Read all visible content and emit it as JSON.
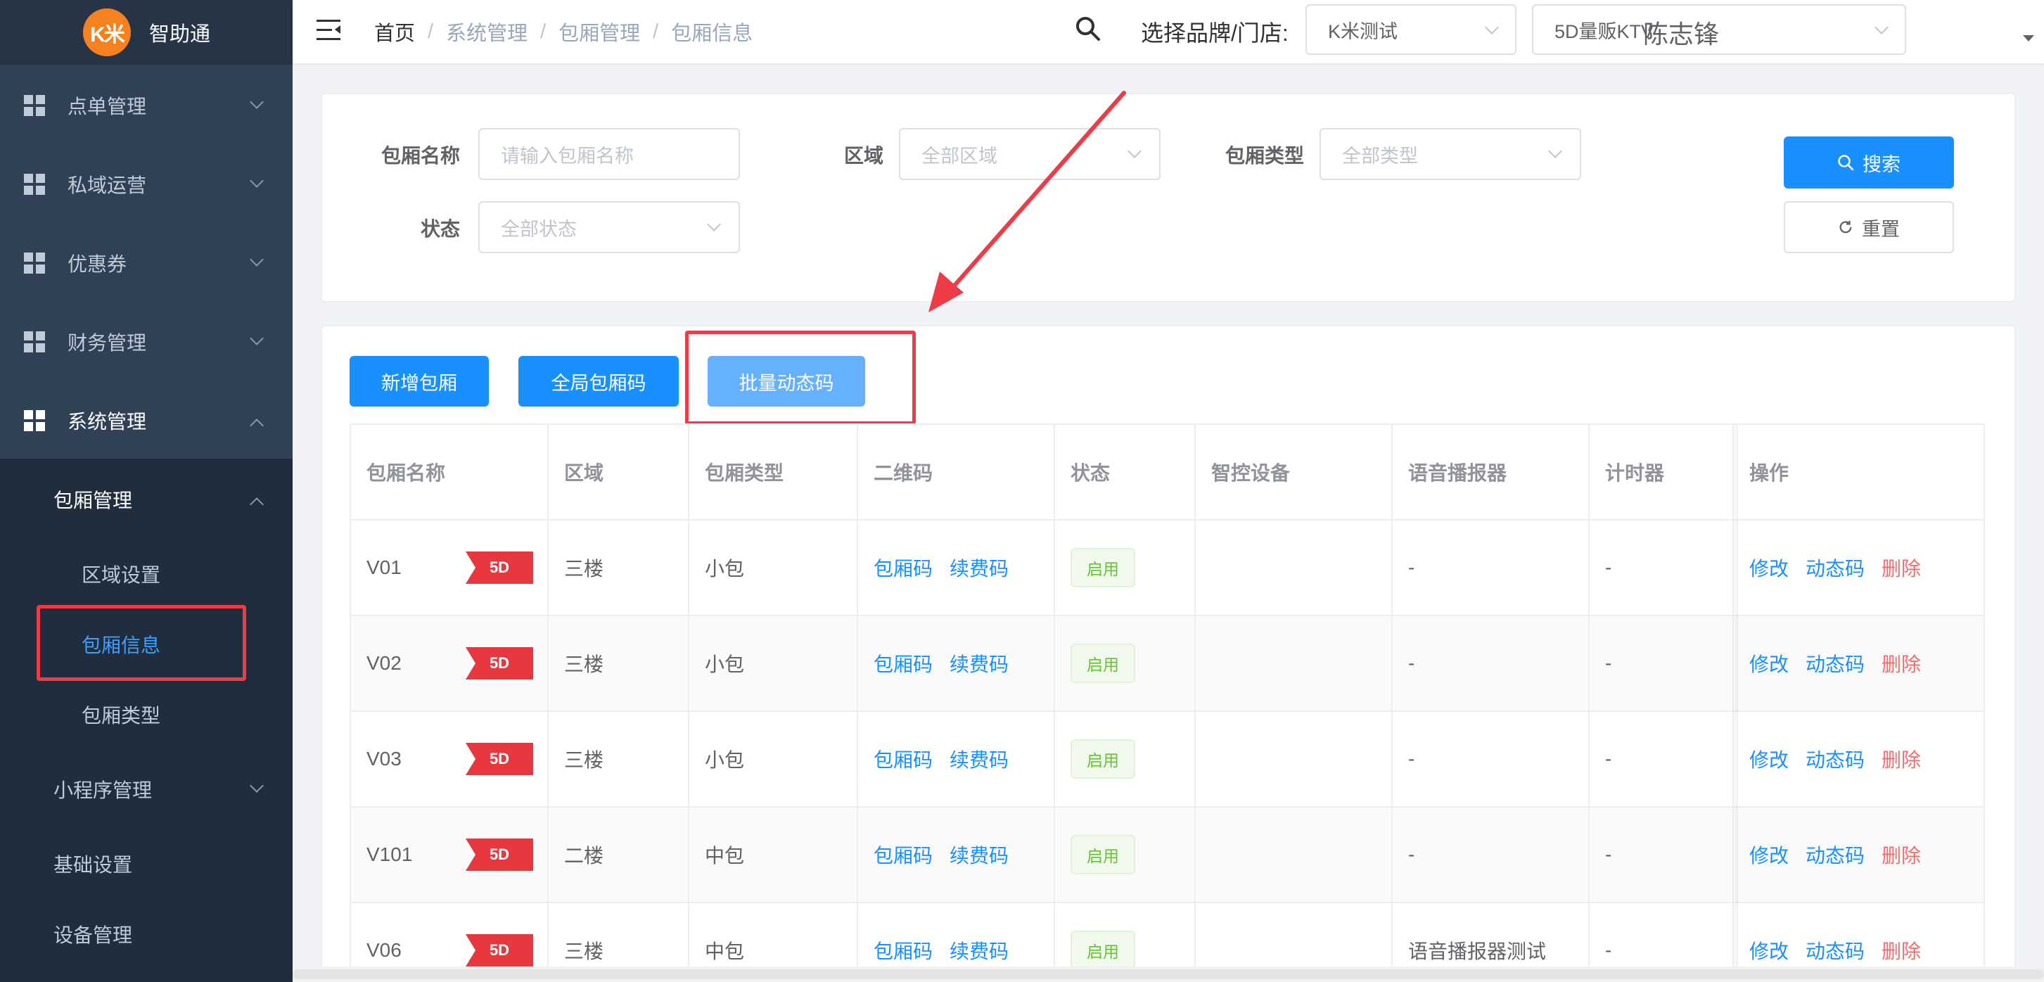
{
  "app": {
    "logo_text": "K米",
    "name": "智助通"
  },
  "sidebar": {
    "items": [
      {
        "label": "点单管理"
      },
      {
        "label": "私域运营"
      },
      {
        "label": "优惠券"
      },
      {
        "label": "财务管理"
      },
      {
        "label": "系统管理"
      }
    ],
    "system_sub": [
      {
        "label": "包厢管理"
      },
      {
        "label": "区域设置"
      },
      {
        "label": "包厢信息"
      },
      {
        "label": "包厢类型"
      },
      {
        "label": "小程序管理"
      },
      {
        "label": "基础设置"
      },
      {
        "label": "设备管理"
      }
    ]
  },
  "header": {
    "breadcrumb": [
      "首页",
      "系统管理",
      "包厢管理",
      "包厢信息"
    ],
    "store_label": "选择品牌/门店:",
    "brand_value": "K米测试",
    "store_value": "5D量贩KTV",
    "user_name": "陈志锋"
  },
  "filters": {
    "name_label": "包厢名称",
    "name_placeholder": "请输入包厢名称",
    "area_label": "区域",
    "area_placeholder": "全部区域",
    "type_label": "包厢类型",
    "type_placeholder": "全部类型",
    "status_label": "状态",
    "status_placeholder": "全部状态",
    "search_btn": "搜索",
    "reset_btn": "重置"
  },
  "toolbar": {
    "add_btn": "新增包厢",
    "global_code_btn": "全局包厢码",
    "batch_code_btn": "批量动态码"
  },
  "table": {
    "columns": [
      "包厢名称",
      "区域",
      "包厢类型",
      "二维码",
      "状态",
      "智控设备",
      "语音播报器",
      "计时器",
      "操作"
    ],
    "rows": [
      {
        "name": "V01",
        "tag": "5D",
        "area": "三楼",
        "type": "小包",
        "qr1": "包厢码",
        "qr2": "续费码",
        "status": "启用",
        "device": "",
        "voice": "-",
        "timer": "-",
        "op_edit": "修改",
        "op_dyn": "动态码",
        "op_del": "删除"
      },
      {
        "name": "V02",
        "tag": "5D",
        "area": "三楼",
        "type": "小包",
        "qr1": "包厢码",
        "qr2": "续费码",
        "status": "启用",
        "device": "",
        "voice": "-",
        "timer": "-",
        "op_edit": "修改",
        "op_dyn": "动态码",
        "op_del": "删除"
      },
      {
        "name": "V03",
        "tag": "5D",
        "area": "三楼",
        "type": "小包",
        "qr1": "包厢码",
        "qr2": "续费码",
        "status": "启用",
        "device": "",
        "voice": "-",
        "timer": "-",
        "op_edit": "修改",
        "op_dyn": "动态码",
        "op_del": "删除"
      },
      {
        "name": "V101",
        "tag": "5D",
        "area": "二楼",
        "type": "中包",
        "qr1": "包厢码",
        "qr2": "续费码",
        "status": "启用",
        "device": "",
        "voice": "-",
        "timer": "-",
        "op_edit": "修改",
        "op_dyn": "动态码",
        "op_del": "删除"
      },
      {
        "name": "V06",
        "tag": "5D",
        "area": "三楼",
        "type": "中包",
        "qr1": "包厢码",
        "qr2": "续费码",
        "status": "启用",
        "device": "",
        "voice": "语音播报器测试",
        "timer": "-",
        "op_edit": "修改",
        "op_dyn": "动态码",
        "op_del": "删除"
      }
    ]
  },
  "colors": {
    "primary": "#1890ff",
    "sidebar": "#304156",
    "annotation": "#ee3b46",
    "tag_red": "#e8383f",
    "success": "#67c23a",
    "danger": "#f56c6c"
  }
}
